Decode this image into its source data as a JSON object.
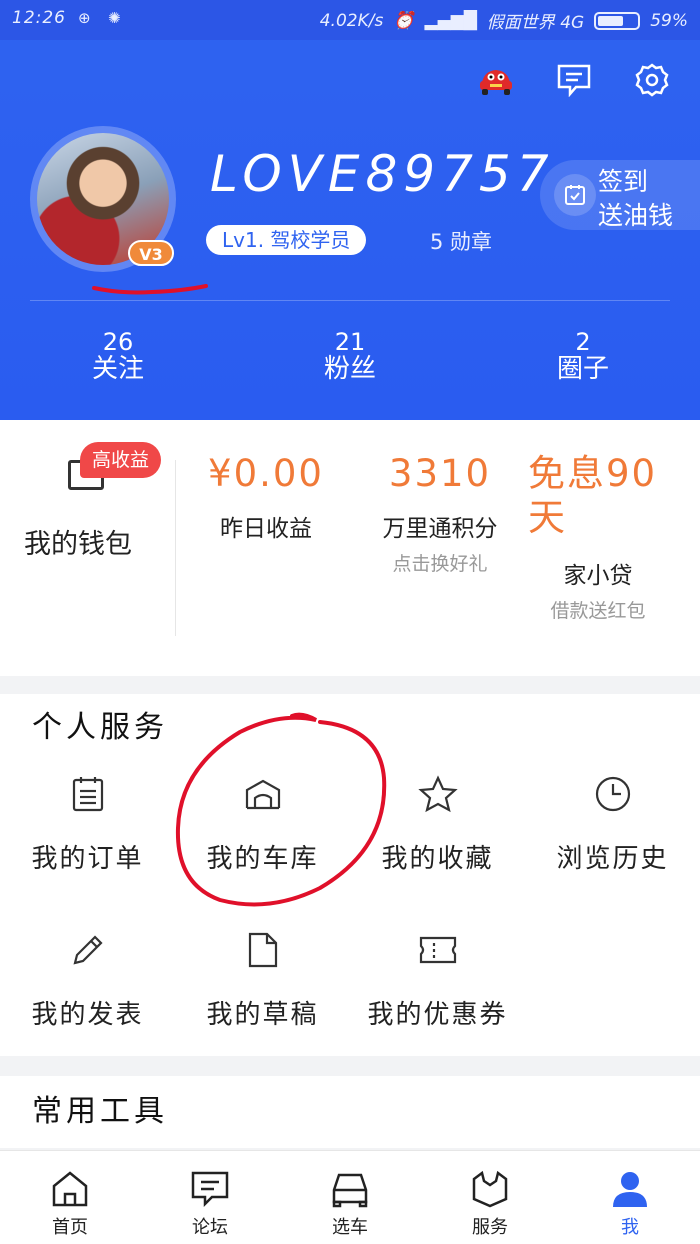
{
  "status_bar": {
    "time": "12:26",
    "speed": "4.02K/s",
    "carrier": "假面世界 4G",
    "battery": "59%"
  },
  "profile": {
    "username": "LOVE89757",
    "level": "Lv1. 驾校学员",
    "medals": "5 勋章",
    "vip_badge": "V3",
    "signin_line1": "签到",
    "signin_line2": "送油钱",
    "stats": [
      {
        "num": "26",
        "label": "关注"
      },
      {
        "num": "21",
        "label": "粉丝"
      },
      {
        "num": "2",
        "label": "圈子"
      }
    ]
  },
  "wallet": {
    "hot_badge": "高收益",
    "label": "我的钱包",
    "yesterday_value": "¥0.00",
    "yesterday_label": "昨日收益",
    "points_value": "3310",
    "points_label": "万里通积分",
    "points_hint": "点击换好礼",
    "loan_value": "免息90天",
    "loan_label": "家小贷",
    "loan_hint": "借款送红包"
  },
  "services": {
    "title": "个人服务",
    "items": [
      {
        "label": "我的订单",
        "icon": "clipboard-icon"
      },
      {
        "label": "我的车库",
        "icon": "garage-icon"
      },
      {
        "label": "我的收藏",
        "icon": "star-icon"
      },
      {
        "label": "浏览历史",
        "icon": "clock-icon"
      },
      {
        "label": "我的发表",
        "icon": "pencil-icon"
      },
      {
        "label": "我的草稿",
        "icon": "document-icon"
      },
      {
        "label": "我的优惠券",
        "icon": "ticket-icon"
      }
    ]
  },
  "tools": {
    "title": "常用工具"
  },
  "bottom_nav": [
    {
      "label": "首页",
      "icon": "home-icon"
    },
    {
      "label": "论坛",
      "icon": "forum-icon"
    },
    {
      "label": "选车",
      "icon": "car-icon"
    },
    {
      "label": "服务",
      "icon": "service-icon"
    },
    {
      "label": "我",
      "icon": "profile-icon",
      "active": true
    }
  ],
  "colors": {
    "brand_blue": "#2f63f0",
    "accent_orange": "#f07a38",
    "hot_red": "#f04848",
    "annotation_red": "#e0102a"
  }
}
